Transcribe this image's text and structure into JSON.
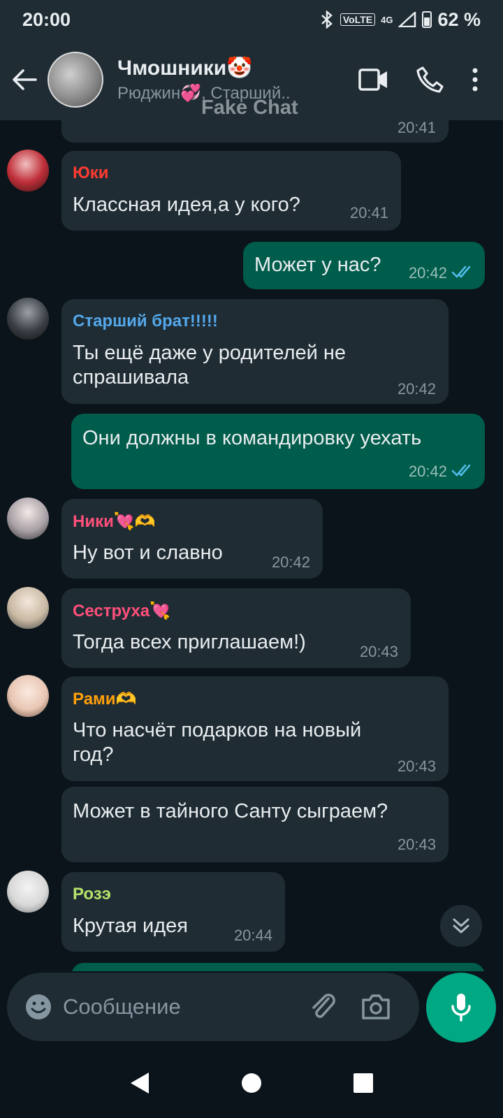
{
  "status_bar": {
    "time": "20:00",
    "volte": "VoLTE",
    "network": "4G",
    "battery": "62 %"
  },
  "header": {
    "title": "Чмошники🤡",
    "members": "Рюджин💞, Старший..",
    "watermark": "Fake Chat"
  },
  "messages": [
    {
      "time": "20:41"
    },
    {
      "sender": "Юки",
      "sender_color": "#ff3b30",
      "text": "Классная идея,а у кого?",
      "time": "20:41"
    },
    {
      "text": "Может у нас?",
      "time": "20:42"
    },
    {
      "sender": "Старший брат!!!!!",
      "sender_color": "#53bdeb",
      "text": "Ты ещё даже у родителей не спрашивала",
      "time": "20:42"
    },
    {
      "text": "Они должны в командировку уехать",
      "time": "20:42"
    },
    {
      "sender": "Ники💘🫶",
      "sender_color": "#ff4f7b",
      "text": "Ну вот и славно",
      "time": "20:42"
    },
    {
      "sender": "Сеструха💘",
      "sender_color": "#ff4f7b",
      "text": "Тогда всех приглашаем!)",
      "time": "20:43"
    },
    {
      "sender": "Рами🫶",
      "sender_color": "#ff9f0a",
      "text": "Что насчёт подарков на новый год?",
      "time": "20:43"
    },
    {
      "text": "Может в тайного Санту сыграем?",
      "time": "20:43"
    },
    {
      "sender": "Розэ",
      "sender_color": "#b7e36b",
      "text": "Крутая идея",
      "time": "20:44"
    }
  ],
  "input": {
    "placeholder": "Сообщение"
  },
  "colors": {
    "header_bg": "#1f2c34",
    "chat_bg": "#0b141a",
    "incoming": "#1f2c34",
    "outgoing": "#005c4b",
    "accent": "#00a884",
    "read_ticks": "#53bdeb"
  }
}
